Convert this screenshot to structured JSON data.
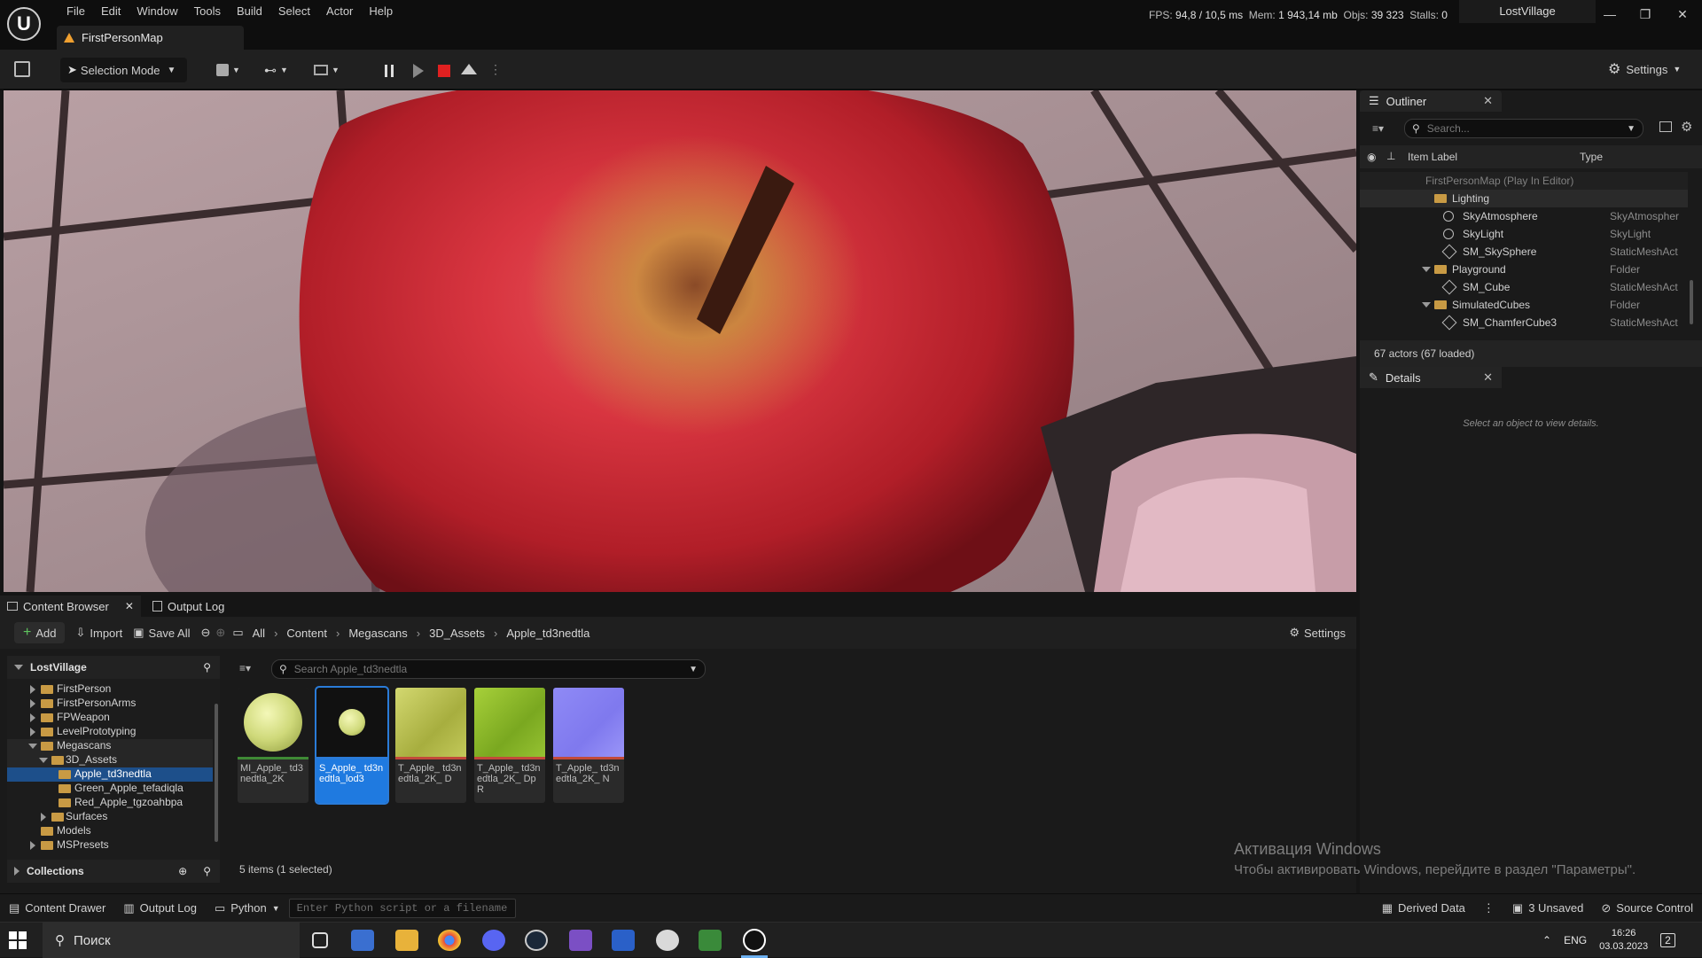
{
  "menu": [
    "File",
    "Edit",
    "Window",
    "Tools",
    "Build",
    "Select",
    "Actor",
    "Help"
  ],
  "level_tab": "FirstPersonMap",
  "stats": {
    "fps_label": "FPS:",
    "fps": "94,8",
    "ms": "/ 10,5 ms",
    "mem_label": "Mem:",
    "mem": "1 943,14 mb",
    "objs_label": "Objs:",
    "objs": "39 323",
    "stalls_label": "Stalls:",
    "stalls": "0"
  },
  "project_name": "LostVillage",
  "window_controls": {
    "minimize": "—",
    "restore": "❐",
    "close": "✕"
  },
  "toolbar": {
    "selection_mode": "Selection Mode",
    "settings": "Settings"
  },
  "outliner": {
    "tab": "Outliner",
    "search_placeholder": "Search...",
    "col_label": "Item Label",
    "col_type": "Type",
    "rows": [
      {
        "label": "FirstPersonMap (Play In Editor)",
        "type": ""
      },
      {
        "label": "Lighting",
        "type": ""
      },
      {
        "label": "SkyAtmosphere",
        "type": "SkyAtmospher"
      },
      {
        "label": "SkyLight",
        "type": "SkyLight"
      },
      {
        "label": "SM_SkySphere",
        "type": "StaticMeshAct"
      },
      {
        "label": "Playground",
        "type": "Folder"
      },
      {
        "label": "SM_Cube",
        "type": "StaticMeshAct"
      },
      {
        "label": "SimulatedCubes",
        "type": "Folder"
      },
      {
        "label": "SM_ChamferCube3",
        "type": "StaticMeshAct"
      }
    ],
    "actor_count": "67 actors (67 loaded)"
  },
  "details": {
    "tab": "Details",
    "empty": "Select an object to view details."
  },
  "content_browser": {
    "tab": "Content Browser",
    "output_tab": "Output Log",
    "add": "Add",
    "import": "Import",
    "save_all": "Save All",
    "breadcrumbs": [
      "All",
      "Content",
      "Megascans",
      "3D_Assets",
      "Apple_td3nedtla"
    ],
    "settings": "Settings",
    "root": "LostVillage",
    "tree": [
      {
        "label": "FirstPerson",
        "depth": 1,
        "exp": "closed"
      },
      {
        "label": "FirstPersonArms",
        "depth": 1,
        "exp": "closed"
      },
      {
        "label": "FPWeapon",
        "depth": 1,
        "exp": "closed"
      },
      {
        "label": "LevelPrototyping",
        "depth": 1,
        "exp": "closed"
      },
      {
        "label": "Megascans",
        "depth": 1,
        "exp": "open"
      },
      {
        "label": "3D_Assets",
        "depth": 2,
        "exp": "open"
      },
      {
        "label": "Apple_td3nedtla",
        "depth": 3,
        "exp": "none",
        "selected": true
      },
      {
        "label": "Green_Apple_tefadiqla",
        "depth": 3,
        "exp": "none"
      },
      {
        "label": "Red_Apple_tgzoahbpa",
        "depth": 3,
        "exp": "none"
      },
      {
        "label": "Surfaces",
        "depth": 2,
        "exp": "closed"
      },
      {
        "label": "Models",
        "depth": 1,
        "exp": "none"
      },
      {
        "label": "MSPresets",
        "depth": 1,
        "exp": "closed"
      }
    ],
    "collections": "Collections",
    "search_placeholder": "Search Apple_td3nedtla",
    "assets": [
      {
        "name": "MI_Apple_ td3nedtla_2K",
        "color": "#cfd97a",
        "bar": "#3f8a35"
      },
      {
        "name": "S_Apple_ td3nedtla_lod3",
        "color": "#111111",
        "bar": "#2a7bd8",
        "selected": true
      },
      {
        "name": "T_Apple_ td3nedtla_2K_ D",
        "color": "#b7bf54",
        "bar": "#c24a3a"
      },
      {
        "name": "T_Apple_ td3nedtla_2K_ DpR",
        "color": "#8cbc2c",
        "bar": "#c24a3a"
      },
      {
        "name": "T_Apple_ td3nedtla_2K_ N",
        "color": "#8c86f2",
        "bar": "#c24a3a"
      }
    ],
    "item_count": "5 items (1 selected)"
  },
  "activation": {
    "title": "Активация Windows",
    "body": "Чтобы активировать Windows, перейдите в раздел \"Параметры\"."
  },
  "statusbar": {
    "content_drawer": "Content Drawer",
    "output_log": "Output Log",
    "python": "Python",
    "python_placeholder": "Enter Python script or a filename",
    "derived_data": "Derived Data",
    "unsaved": "3 Unsaved",
    "source_control": "Source Control"
  },
  "taskbar": {
    "search": "Поиск",
    "lang": "ENG",
    "time": "16:26",
    "date": "03.03.2023",
    "notif": "2"
  }
}
